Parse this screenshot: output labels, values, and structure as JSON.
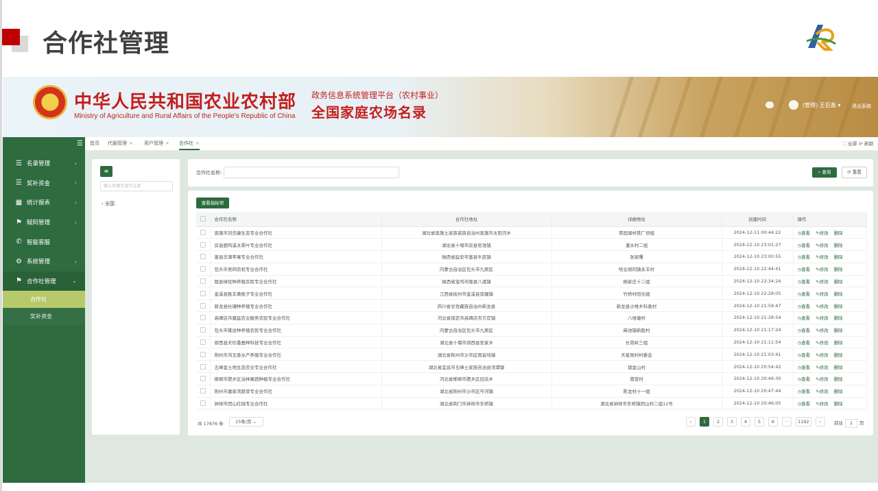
{
  "slide": {
    "title": "合作社管理"
  },
  "header": {
    "ministry_cn": "中华人民共和国农业农村部",
    "ministry_en": "Ministry of Agriculture and Rural Affairs of the People's Republic of China",
    "platform_sub": "政务信息系统管理平台（农村事业）",
    "platform_main": "全国家庭农场名录",
    "user": "(管理) 王巨鑫 ▾",
    "logout": "退出系统"
  },
  "tabs": [
    {
      "label": "首页"
    },
    {
      "label": "代服管理"
    },
    {
      "label": "用户管理"
    },
    {
      "label": "合作社"
    }
  ],
  "tab_tools": "⛶ 全屏  ⟳ 刷新",
  "sidebar": {
    "items": [
      {
        "label": "名录管理",
        "icon": "list-icon"
      },
      {
        "label": "奖补资金",
        "icon": "list-icon"
      },
      {
        "label": "统计报表",
        "icon": "grid-icon"
      },
      {
        "label": "赋码管理",
        "icon": "flag-icon"
      },
      {
        "label": "智能客服",
        "icon": "phone-icon"
      },
      {
        "label": "系统管理",
        "icon": "gear-icon"
      },
      {
        "label": "合作社管理",
        "icon": "flag-icon"
      }
    ],
    "sub_items": [
      {
        "label": "合作社"
      },
      {
        "label": "奖补资金"
      }
    ]
  },
  "tree": {
    "placeholder": "输入关键字进行过滤",
    "root": "全国"
  },
  "search": {
    "label": "合作社名称:",
    "query_button": "查询",
    "reset_button": "重置"
  },
  "table": {
    "indicator_button": "查看指标项",
    "headers": [
      "合作社名称",
      "合作社地址",
      "详细地址",
      "创建时间",
      "操作"
    ],
    "actions": {
      "view": "查看",
      "edit": "修改",
      "delete": "删除"
    },
    "rows": [
      [
        "恩施市刘氏康生态专业合作社",
        "湖北省恩施土家族苗族自治州恩施市太阳河乡",
        "茶园湖村铁厂坝组",
        "2024-12-11 00:44:22"
      ],
      [
        "房县鹿鸣溪水茶叶专业合作社",
        "湖北省十堰市房县窑淮镇",
        "潘水村二组",
        "2024-12-10 23:01:27"
      ],
      [
        "富县华源苹果专业合作社",
        "陕西省延安市富县牛武镇",
        "张家曙",
        "2024-12-10 23:00:55"
      ],
      [
        "包头市吴四农机专业合作社",
        "内蒙古自治区包头市九原区",
        "哈业胡同镇永丰村",
        "2024-12-10 22:44:41"
      ],
      [
        "陇县绿优种养殖农民专业合作社",
        "陕西省宝鸡市陇县八渡镇",
        "杨家庄十二组",
        "2024-12-10 22:34:24"
      ],
      [
        "金溪县胜丰黄栀子专业合作社",
        "江西省抚州市金溪县双塘镇",
        "竹桥村阳光组",
        "2024-12-10 22:28:05"
      ],
      [
        "新龙县杜珊种养殖专业合作社",
        "四川省甘孜藏族自治州新龙县",
        "新龙县沙堆乡科善村",
        "2024-12-10 21:59:47"
      ],
      [
        "高碑店市嘉猛农业服务农民专业合作社",
        "河北省保定市高碑店市方官镇",
        "八堆塘村",
        "2024-12-10 21:28:54"
      ],
      [
        "包头市雍途种养殖农民专业合作社",
        "内蒙古自治区包头市九原区",
        "麻池镇新胜村",
        "2024-12-10 21:17:24"
      ],
      [
        "郧西县天珍桑蚕种科技专业合作社",
        "湖北省十堰市郧西县安家乡",
        "长岗岭三组",
        "2024-12-10 21:11:54"
      ],
      [
        "荆州市鸿玉香水产养殖专业合作社",
        "湖北省荆州市沙市区观音垱镇",
        "天星观村村委会",
        "2024-12-10 21:03:41"
      ],
      [
        "五峰金土地生态农业专业合作社",
        "湖北省宜昌市五峰土家族自治县湾潭镇",
        "锁金山村",
        "2024-12-10 20:54:42"
      ],
      [
        "邯郸市肥乡区治林果蔬种植专业合作社",
        "河北省邯郸市肥乡区旧店乡",
        "南营村",
        "2024-12-10 20:49:30"
      ],
      [
        "荆州市嘉家湾蔬菜专业合作社",
        "湖北省荆州市沙市区岑河镇",
        "陈龙村十一组",
        "2024-12-10 20:47:44"
      ],
      [
        "钟祥市团山红桃专业合作社",
        "湖北省荆门市钟祥市东桥镇",
        "湖北省钟祥市东桥镇团山村二组12号",
        "2024-12-10 20:46:05"
      ]
    ]
  },
  "pagination": {
    "total": "共 17876 条",
    "page_size": "15条/页",
    "pages": [
      "‹",
      "1",
      "2",
      "3",
      "4",
      "5",
      "6",
      "···",
      "1192",
      "›"
    ],
    "goto_label": "前往",
    "goto_value": "1",
    "goto_suffix": "页"
  }
}
